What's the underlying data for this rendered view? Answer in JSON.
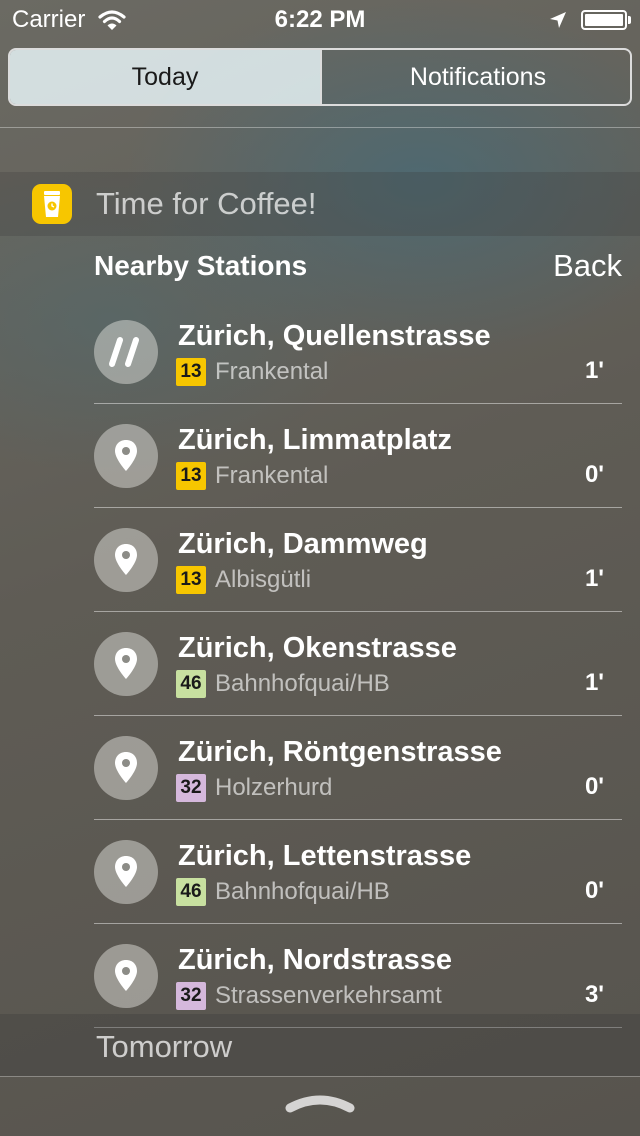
{
  "status_bar": {
    "carrier": "Carrier",
    "time": "6:22 PM"
  },
  "segmented_control": {
    "today": "Today",
    "notifications": "Notifications",
    "selected": "Today"
  },
  "widget": {
    "title": "Time for Coffee!",
    "icon": "coffee-cup-icon",
    "icon_color": "#f7c600",
    "section_title": "Nearby Stations",
    "back_label": "Back",
    "stations": [
      {
        "name": "Zürich, Quellenstrasse",
        "line": "13",
        "line_color": "#f7c600",
        "destination": "Frankental",
        "minutes": "1'",
        "icon": "favorite-slash-icon"
      },
      {
        "name": "Zürich, Limmatplatz",
        "line": "13",
        "line_color": "#f7c600",
        "destination": "Frankental",
        "minutes": "0'",
        "icon": "location-pin-icon"
      },
      {
        "name": "Zürich, Dammweg",
        "line": "13",
        "line_color": "#f7c600",
        "destination": "Albisgütli",
        "minutes": "1'",
        "icon": "location-pin-icon"
      },
      {
        "name": "Zürich, Okenstrasse",
        "line": "46",
        "line_color": "#c8e0a0",
        "destination": "Bahnhofquai/HB",
        "minutes": "1'",
        "icon": "location-pin-icon"
      },
      {
        "name": "Zürich, Röntgenstrasse",
        "line": "32",
        "line_color": "#d5b8dc",
        "destination": "Holzerhurd",
        "minutes": "0'",
        "icon": "location-pin-icon"
      },
      {
        "name": "Zürich, Lettenstrasse",
        "line": "46",
        "line_color": "#c8e0a0",
        "destination": "Bahnhofquai/HB",
        "minutes": "0'",
        "icon": "location-pin-icon"
      },
      {
        "name": "Zürich, Nordstrasse",
        "line": "32",
        "line_color": "#d5b8dc",
        "destination": "Strassenverkehrsamt",
        "minutes": "3'",
        "icon": "location-pin-icon"
      }
    ]
  },
  "tomorrow": {
    "label": "Tomorrow"
  }
}
